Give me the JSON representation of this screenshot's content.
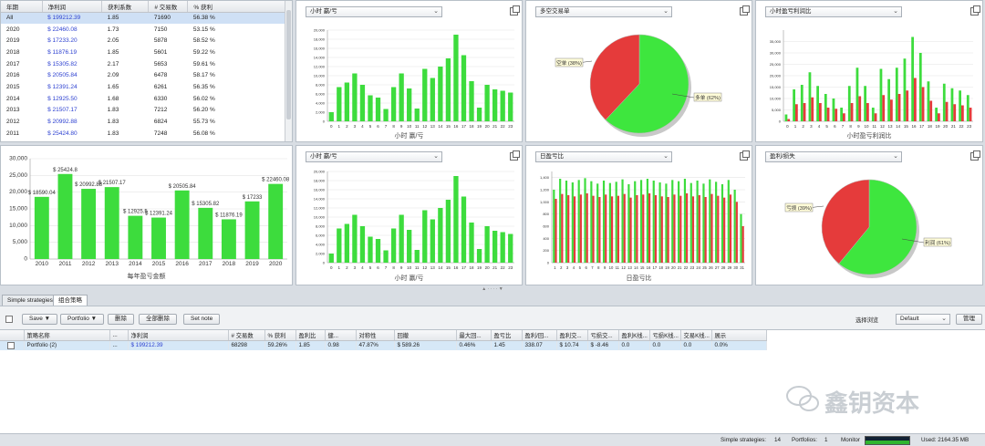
{
  "year_table": {
    "headers": [
      "年期",
      "净利润",
      "获利系数",
      "# 交易数",
      "% 获利"
    ],
    "rows": [
      [
        "All",
        "$ 199212.39",
        "1.85",
        "71690",
        "56.38 %"
      ],
      [
        "2020",
        "$ 22460.08",
        "1.73",
        "7150",
        "53.15 %"
      ],
      [
        "2019",
        "$ 17233.20",
        "2.05",
        "5878",
        "58.52 %"
      ],
      [
        "2018",
        "$ 11876.19",
        "1.85",
        "5601",
        "59.22 %"
      ],
      [
        "2017",
        "$ 15305.82",
        "2.17",
        "5653",
        "59.61 %"
      ],
      [
        "2016",
        "$ 20505.84",
        "2.09",
        "6478",
        "58.17 %"
      ],
      [
        "2015",
        "$ 12391.24",
        "1.65",
        "6261",
        "56.35 %"
      ],
      [
        "2014",
        "$ 12925.50",
        "1.68",
        "6330",
        "56.02 %"
      ],
      [
        "2013",
        "$ 21507.17",
        "1.83",
        "7212",
        "56.20 %"
      ],
      [
        "2012",
        "$ 20992.88",
        "1.83",
        "6824",
        "55.73 %"
      ],
      [
        "2011",
        "$ 25424.80",
        "1.83",
        "7248",
        "56.08 %"
      ]
    ]
  },
  "panels": {
    "p2_select": "小时 赢/亏",
    "p3_select": "多空交易单",
    "p4_select": "小时盈亏利润比",
    "p6_select": "小时 赢/亏",
    "p7_select": "日盈亏比",
    "p8_select": "盈利/损失",
    "p2_caption": "小时 赢/亏",
    "p4_caption": "小时盈亏利润比",
    "p5_caption": "每年盈亏金额",
    "p6_caption": "小时 赢/亏",
    "p7_caption": "日盈亏比"
  },
  "chart_data": [
    {
      "type": "bar",
      "xlabel": "小时 赢/亏",
      "categories": [
        "0",
        "1",
        "2",
        "3",
        "4",
        "5",
        "6",
        "7",
        "8",
        "9",
        "10",
        "11",
        "12",
        "13",
        "14",
        "15",
        "16",
        "17",
        "18",
        "19",
        "20",
        "21",
        "22",
        "23"
      ],
      "values": [
        2000,
        7500,
        8500,
        10500,
        8000,
        5700,
        5200,
        2700,
        7500,
        10500,
        7200,
        2800,
        11500,
        9500,
        12000,
        13800,
        19000,
        14500,
        8800,
        3000,
        8000,
        7000,
        6700,
        6300
      ],
      "ylim": [
        0,
        20000
      ],
      "yticks": [
        "0",
        "2,000",
        "4,000",
        "6,000",
        "8,000",
        "10,000",
        "12,000",
        "14,000",
        "16,000",
        "18,000",
        "20,000"
      ],
      "color": "#3ddc3d"
    },
    {
      "type": "pie",
      "slices": [
        {
          "label": "空单 (38%)",
          "value": 38,
          "color": "#e53b3b"
        },
        {
          "label": "多单 (62%)",
          "value": 62,
          "color": "#3ee63e"
        }
      ]
    },
    {
      "type": "bar",
      "xlabel": "小时盈亏利润比",
      "categories": [
        "0",
        "1",
        "2",
        "3",
        "4",
        "5",
        "6",
        "7",
        "8",
        "9",
        "10",
        "11",
        "12",
        "13",
        "14",
        "15",
        "16",
        "17",
        "18",
        "19",
        "20",
        "21",
        "22",
        "23"
      ],
      "series": [
        {
          "color": "#3ddc3d",
          "values": [
            3000,
            14000,
            16000,
            21500,
            15500,
            12000,
            10000,
            6000,
            15500,
            23500,
            15500,
            6000,
            23000,
            18500,
            23500,
            27500,
            37000,
            30000,
            17500,
            6000,
            16500,
            14500,
            13500,
            11500
          ]
        },
        {
          "color": "#e53b3b",
          "values": [
            1000,
            7500,
            8000,
            10500,
            8000,
            6000,
            5500,
            3500,
            8000,
            11000,
            8000,
            3500,
            11500,
            9500,
            12000,
            13500,
            19000,
            15000,
            9000,
            3500,
            8500,
            7500,
            7000,
            6000
          ]
        }
      ],
      "ylim": [
        0,
        40000
      ],
      "yticks": [
        "0",
        "5,000",
        "10,000",
        "15,000",
        "20,000",
        "25,000",
        "30,000",
        "35,000"
      ]
    },
    {
      "type": "bar",
      "xlabel": "每年盈亏金额",
      "categories": [
        "2010",
        "2011",
        "2012",
        "2013",
        "2014",
        "2015",
        "2016",
        "2017",
        "2018",
        "2019",
        "2020"
      ],
      "values": [
        18590.04,
        25424.8,
        20992.88,
        21507.17,
        12925.5,
        12391.24,
        20505.84,
        15305.82,
        11876.19,
        17233.2,
        22460.08
      ],
      "data_labels": [
        "$ 18590.04",
        "$ 25424.8",
        "$ 20992.88",
        "$ 21507.17",
        "$ 12925.5",
        "$ 12391.24",
        "$ 20505.84",
        "$ 15305.82",
        "$ 11876.19",
        "$ 17233",
        "$ 22460.08"
      ],
      "ylim": [
        0,
        30000
      ],
      "yticks": [
        "0",
        "5,000",
        "10,000",
        "15,000",
        "20,000",
        "25,000",
        "30,000"
      ],
      "color": "#3ddc3d"
    },
    {
      "type": "bar",
      "xlabel": "小时 赢/亏",
      "categories": [
        "0",
        "1",
        "2",
        "3",
        "4",
        "5",
        "6",
        "7",
        "8",
        "9",
        "10",
        "11",
        "12",
        "13",
        "14",
        "15",
        "16",
        "17",
        "18",
        "19",
        "20",
        "21",
        "22",
        "23"
      ],
      "values": [
        2000,
        7500,
        8500,
        10500,
        8000,
        5700,
        5200,
        2700,
        7500,
        10500,
        7200,
        2800,
        11500,
        9500,
        12000,
        13800,
        19000,
        14500,
        8800,
        3000,
        8000,
        7000,
        6700,
        6300
      ],
      "ylim": [
        0,
        20000
      ],
      "yticks": [
        "0",
        "2,000",
        "4,000",
        "6,000",
        "8,000",
        "10,000",
        "12,000",
        "14,000",
        "16,000",
        "18,000",
        "20,000"
      ],
      "color": "#3ddc3d"
    },
    {
      "type": "bar",
      "xlabel": "日盈亏比",
      "categories": [
        "1",
        "2",
        "3",
        "4",
        "5",
        "6",
        "7",
        "8",
        "9",
        "10",
        "11",
        "12",
        "13",
        "14",
        "15",
        "16",
        "17",
        "18",
        "19",
        "20",
        "21",
        "22",
        "23",
        "24",
        "25",
        "26",
        "27",
        "28",
        "29",
        "30",
        "31"
      ],
      "series": [
        {
          "color": "#3ddc3d",
          "values": [
            1200,
            1380,
            1350,
            1320,
            1360,
            1390,
            1340,
            1300,
            1350,
            1310,
            1330,
            1370,
            1290,
            1340,
            1360,
            1380,
            1350,
            1320,
            1300,
            1360,
            1340,
            1380,
            1310,
            1350,
            1300,
            1370,
            1330,
            1290,
            1360,
            1200,
            800
          ]
        },
        {
          "color": "#e53b3b",
          "values": [
            1050,
            1130,
            1110,
            1090,
            1120,
            1140,
            1100,
            1080,
            1120,
            1090,
            1100,
            1130,
            1070,
            1110,
            1120,
            1140,
            1110,
            1090,
            1080,
            1120,
            1100,
            1140,
            1090,
            1110,
            1080,
            1130,
            1100,
            1070,
            1120,
            1000,
            600
          ]
        }
      ],
      "ylim": [
        0,
        1500
      ],
      "yticks": [
        "0",
        "200",
        "400",
        "600",
        "800",
        "1,000",
        "1,200",
        "1,400"
      ]
    },
    {
      "type": "pie",
      "slices": [
        {
          "label": "亏损 (39%)",
          "value": 39,
          "color": "#e53b3b"
        },
        {
          "label": "利润 (61%)",
          "value": 61,
          "color": "#3ee63e"
        }
      ]
    }
  ],
  "tabs": [
    "Simple strategies",
    "组合策略"
  ],
  "toolbar": {
    "save": "Save ▼",
    "portfolio": "Portfolio ▼",
    "delete": "删除",
    "delete_all": "全部删除",
    "set_note": "Set note",
    "view_label": "选择浏览",
    "view_value": "Default",
    "manage": "管理"
  },
  "grid": {
    "headers": [
      "策略名称",
      "...",
      "净利润",
      "# 交易数",
      "% 获利",
      "盈利比",
      "健...",
      "对称性",
      "回撤",
      "最大回...",
      "盈亏比",
      "盈利/回...",
      "盈利交...",
      "亏损交...",
      "盈利K线...",
      "亏损K线...",
      "交易K线...",
      "展示"
    ],
    "row": [
      "Portfolio (2)",
      "...",
      "$ 199212.39",
      "68298",
      "59.26%",
      "1.85",
      "0.98",
      "47.87%",
      "$ 589.26",
      "0.46%",
      "1.45",
      "338.07",
      "$ 10.74",
      "$ -8.46",
      "0.0",
      "0.0",
      "0.0",
      "0.0%"
    ]
  },
  "status": {
    "simple_label": "Simple strategies:",
    "simple_value": "14",
    "portfolios_label": "Portfolios:",
    "portfolios_value": "1",
    "monitor_label": "Monitor",
    "used": "Used: 2164.35 MB"
  },
  "watermark": "鑫钥资本"
}
